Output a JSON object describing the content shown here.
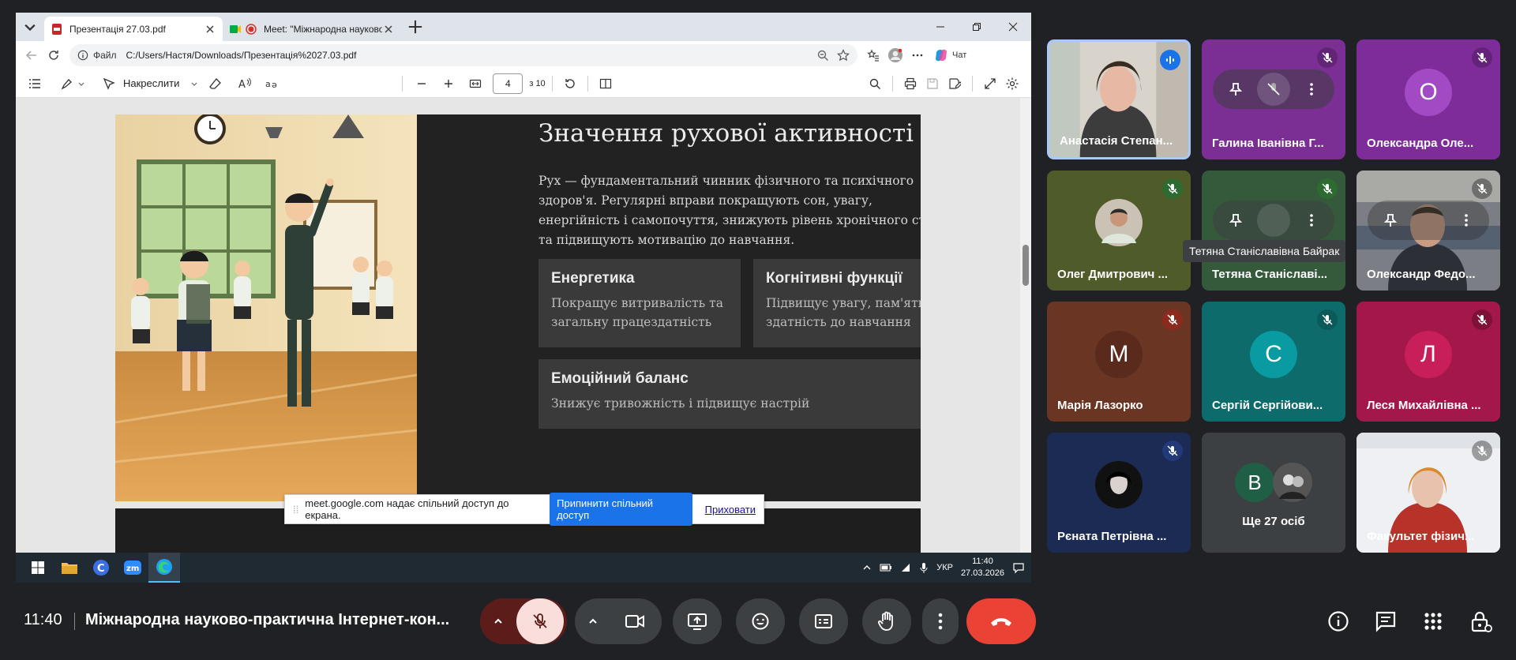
{
  "browser": {
    "tabs": [
      {
        "title": "Презентація 27.03.pdf",
        "active": true
      },
      {
        "title": "Meet: \"Міжнародна науково",
        "active": false
      }
    ],
    "address_label": "Файл",
    "address_url": "C:/Users/Настя/Downloads/Презентація%2027.03.pdf",
    "copilot_label": "Чат"
  },
  "pdf_toolbar": {
    "draw_label": "Накреслити",
    "page_current": "4",
    "page_total": "з 10"
  },
  "slide": {
    "title": "Значення рухової активності",
    "body": "Рух — фундаментальний чинник фізичного та психічного здоров'я. Регулярні вправи покращують сон, увагу, енергійність і самопочуття, знижують рівень хронічного стресу та підвищують мотивацію до навчання.",
    "cards": [
      {
        "title": "Енергетика",
        "text": "Покращує витривалість та загальну працездатність"
      },
      {
        "title": "Когнітивні функції",
        "text": "Підвищує увагу, пам'ять і здатність до навчання"
      },
      {
        "title": "Емоційний баланс",
        "text": "Знижує тривожність і підвищує настрій"
      }
    ]
  },
  "share_notice": {
    "text": "meet.google.com надає спільний доступ до екрана.",
    "stop_label": "Припинити спільний доступ",
    "hide_label": "Приховати"
  },
  "taskbar": {
    "lang": "УКР",
    "time": "11:40",
    "date": "27.03.2026"
  },
  "participants": [
    {
      "name": "Анастасія Степан...",
      "type": "video",
      "mic": "speaking"
    },
    {
      "name": "Галина Іванівна Г...",
      "type": "avatar",
      "initial": "",
      "bg": "#7b2e93",
      "mic": "muted"
    },
    {
      "name": "Олександра Оле...",
      "type": "avatar",
      "initial": "O",
      "bg": "#8a35a8",
      "mic": "muted"
    },
    {
      "name": "Олег Дмитрович ...",
      "type": "photo",
      "bg": "#4f5b28",
      "mic": "muted-green"
    },
    {
      "name": "Тетяна Станіславі...",
      "type": "avatar",
      "initial": "",
      "bg": "#355a3b",
      "mic": "muted-green"
    },
    {
      "name": "Олександр Федо...",
      "type": "video",
      "mic": "muted"
    },
    {
      "name": "Марія Лазорко",
      "type": "avatar",
      "initial": "M",
      "bg": "#6b3524",
      "mic": "muted-red"
    },
    {
      "name": "Сергій Сергійови...",
      "type": "avatar",
      "initial": "C",
      "bg": "#0d6b6b",
      "mic": "muted-teal"
    },
    {
      "name": "Леся Михайлівна ...",
      "type": "avatar",
      "initial": "Л",
      "bg": "#a3174a",
      "mic": "muted-red"
    },
    {
      "name": "Рєната Петрівна ...",
      "type": "photo",
      "bg": "#1b2b53",
      "mic": "muted"
    },
    {
      "name": "Ще 27 осіб",
      "type": "more",
      "initial": "B",
      "bg": "#3c4043"
    },
    {
      "name": "Факультет фізич...",
      "type": "video",
      "mic": "muted"
    }
  ],
  "tooltip": "Тетяна Станіславівна Байрак",
  "meeting": {
    "time": "11:40",
    "title": "Міжнародна науково-практична Інтернет-кон..."
  },
  "colors": {
    "end_call": "#ea4335",
    "mic_off_bg": "#f9dedc",
    "mic_off_group": "#5c1d1a",
    "accent_blue": "#1a73e8"
  }
}
